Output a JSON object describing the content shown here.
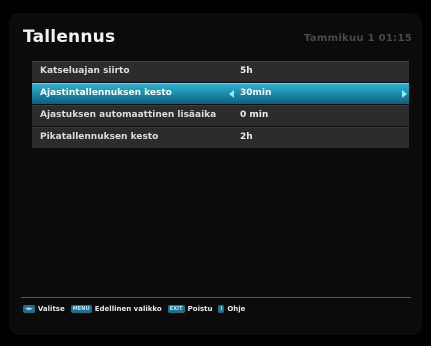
{
  "header": {
    "title": "Tallennus",
    "datetime": "Tammikuu 1 01:15"
  },
  "menu": {
    "items": [
      {
        "label": "Katseluajan siirto",
        "value": "5h"
      },
      {
        "label": "Ajastintallennuksen kesto",
        "value": "30min"
      },
      {
        "label": "Ajastuksen automaattinen lisäaika",
        "value": "0 min"
      },
      {
        "label": "Pikatallennuksen kesto",
        "value": "2h"
      }
    ],
    "selected_index": 1
  },
  "footer": {
    "items": [
      {
        "key": "◄►",
        "text": "Valitse"
      },
      {
        "key": "MENU",
        "text": "Edellinen valikko"
      },
      {
        "key": "EXIT",
        "text": "Poistu"
      },
      {
        "key": "i",
        "text": "Ohje"
      }
    ]
  },
  "colors": {
    "highlight": "#1f97b9",
    "key_badge": "#1f6f8e"
  }
}
